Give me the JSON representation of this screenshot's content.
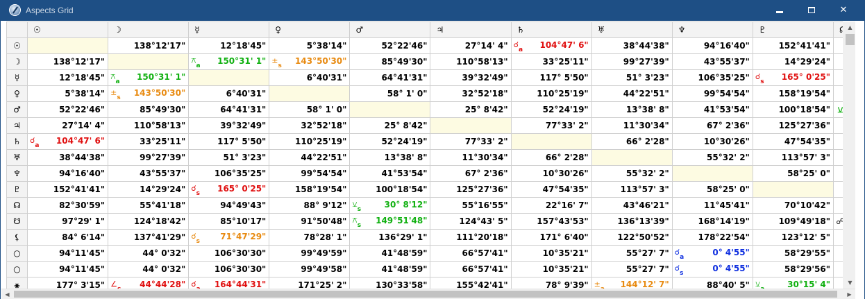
{
  "window": {
    "title": "Aspects Grid",
    "minimize_glyph": "",
    "close_glyph": "✕",
    "icon": "astrology-app-icon"
  },
  "colors": {
    "titlebar": "#1e4f85",
    "glyph_red": "#e01010",
    "aspect_green": "#10b010",
    "aspect_orange": "#e88a10",
    "aspect_red": "#e01010",
    "aspect_blue": "#1030e0",
    "diagonal": "#fdfbe2"
  },
  "grid": {
    "columns": [
      "☉",
      "☽",
      "☿",
      "♀",
      "♂",
      "♃",
      "♄",
      "♅",
      "♆",
      "♇",
      "☊"
    ],
    "rows": [
      {
        "glyph": "☉",
        "cells": [
          {
            "diag": true
          },
          {
            "v": "138°12'17\""
          },
          {
            "v": "12°18'45\""
          },
          {
            "v": "5°38'14\""
          },
          {
            "v": "52°22'46\""
          },
          {
            "v": "27°14' 4\""
          },
          {
            "sym": "☌",
            "sub": "a",
            "v": "104°47' 6\"",
            "c": "red"
          },
          {
            "v": "38°44'38\""
          },
          {
            "v": "94°16'40\""
          },
          {
            "v": "152°41'41\""
          }
        ],
        "edge": ""
      },
      {
        "glyph": "☽",
        "cells": [
          {
            "v": "138°12'17\""
          },
          {
            "diag": true
          },
          {
            "sym": "⚻",
            "sub": "a",
            "v": "150°31' 1\"",
            "c": "green"
          },
          {
            "sym": "±",
            "sub": "s",
            "v": "143°50'30\"",
            "c": "orange"
          },
          {
            "v": "85°49'30\""
          },
          {
            "v": "110°58'13\""
          },
          {
            "v": "33°25'11\""
          },
          {
            "v": "99°27'39\""
          },
          {
            "v": "43°55'37\""
          },
          {
            "v": "14°29'24\""
          }
        ],
        "edge": ""
      },
      {
        "glyph": "☿",
        "cells": [
          {
            "v": "12°18'45\""
          },
          {
            "sym": "⚻",
            "sub": "a",
            "v": "150°31' 1\"",
            "c": "green"
          },
          {
            "diag": true
          },
          {
            "v": "6°40'31\""
          },
          {
            "v": "64°41'31\""
          },
          {
            "v": "39°32'49\""
          },
          {
            "v": "117° 5'50\""
          },
          {
            "v": "51° 3'23\""
          },
          {
            "v": "106°35'25\""
          },
          {
            "sym": "☌",
            "sub": "s",
            "v": "165° 0'25\"",
            "c": "red"
          }
        ],
        "edge": ""
      },
      {
        "glyph": "♀",
        "cells": [
          {
            "v": "5°38'14\""
          },
          {
            "sym": "±",
            "sub": "s",
            "v": "143°50'30\"",
            "c": "orange"
          },
          {
            "v": "6°40'31\""
          },
          {
            "diag": true
          },
          {
            "v": "58° 1' 0\""
          },
          {
            "v": "32°52'18\""
          },
          {
            "v": "110°25'19\""
          },
          {
            "v": "44°22'51\""
          },
          {
            "v": "99°54'54\""
          },
          {
            "v": "158°19'54\""
          }
        ],
        "edge": ""
      },
      {
        "glyph": "♂",
        "cells": [
          {
            "v": "52°22'46\""
          },
          {
            "v": "85°49'30\""
          },
          {
            "v": "64°41'31\""
          },
          {
            "v": "58° 1' 0\""
          },
          {
            "diag": true
          },
          {
            "v": "25° 8'42\""
          },
          {
            "v": "52°24'19\""
          },
          {
            "v": "13°38' 8\""
          },
          {
            "v": "41°53'54\""
          },
          {
            "v": "100°18'54\""
          }
        ],
        "edge": "⚺"
      },
      {
        "glyph": "♃",
        "cells": [
          {
            "v": "27°14' 4\""
          },
          {
            "v": "110°58'13\""
          },
          {
            "v": "39°32'49\""
          },
          {
            "v": "32°52'18\""
          },
          {
            "v": "25° 8'42\""
          },
          {
            "diag": true
          },
          {
            "v": "77°33' 2\""
          },
          {
            "v": "11°30'34\""
          },
          {
            "v": "67° 2'36\""
          },
          {
            "v": "125°27'36\""
          }
        ],
        "edge": ""
      },
      {
        "glyph": "♄",
        "cells": [
          {
            "sym": "☌",
            "sub": "a",
            "v": "104°47' 6\"",
            "c": "red"
          },
          {
            "v": "33°25'11\""
          },
          {
            "v": "117° 5'50\""
          },
          {
            "v": "110°25'19\""
          },
          {
            "v": "52°24'19\""
          },
          {
            "v": "77°33' 2\""
          },
          {
            "diag": true
          },
          {
            "v": "66° 2'28\""
          },
          {
            "v": "10°30'26\""
          },
          {
            "v": "47°54'35\""
          }
        ],
        "edge": ""
      },
      {
        "glyph": "♅",
        "cells": [
          {
            "v": "38°44'38\""
          },
          {
            "v": "99°27'39\""
          },
          {
            "v": "51° 3'23\""
          },
          {
            "v": "44°22'51\""
          },
          {
            "v": "13°38' 8\""
          },
          {
            "v": "11°30'34\""
          },
          {
            "v": "66° 2'28\""
          },
          {
            "diag": true
          },
          {
            "v": "55°32' 2\""
          },
          {
            "v": "113°57' 3\""
          }
        ],
        "edge": ""
      },
      {
        "glyph": "♆",
        "cells": [
          {
            "v": "94°16'40\""
          },
          {
            "v": "43°55'37\""
          },
          {
            "v": "106°35'25\""
          },
          {
            "v": "99°54'54\""
          },
          {
            "v": "41°53'54\""
          },
          {
            "v": "67° 2'36\""
          },
          {
            "v": "10°30'26\""
          },
          {
            "v": "55°32' 2\""
          },
          {
            "diag": true
          },
          {
            "v": "58°25' 0\""
          }
        ],
        "edge": ""
      },
      {
        "glyph": "♇",
        "cells": [
          {
            "v": "152°41'41\""
          },
          {
            "v": "14°29'24\""
          },
          {
            "sym": "☌",
            "sub": "s",
            "v": "165° 0'25\"",
            "c": "red"
          },
          {
            "v": "158°19'54\""
          },
          {
            "v": "100°18'54\""
          },
          {
            "v": "125°27'36\""
          },
          {
            "v": "47°54'35\""
          },
          {
            "v": "113°57' 3\""
          },
          {
            "v": "58°25' 0\""
          },
          {
            "diag": true
          }
        ],
        "edge": ""
      },
      {
        "glyph": "☊",
        "cells": [
          {
            "v": "82°30'59\""
          },
          {
            "v": "55°41'18\""
          },
          {
            "v": "94°49'43\""
          },
          {
            "v": "88° 9'12\""
          },
          {
            "sym": "⚺",
            "sub": "s",
            "v": "30° 8'12\"",
            "c": "green"
          },
          {
            "v": "55°16'55\""
          },
          {
            "v": "22°16' 7\""
          },
          {
            "v": "43°46'21\""
          },
          {
            "v": "11°45'41\""
          },
          {
            "v": "70°10'42\""
          }
        ],
        "edge": ""
      },
      {
        "glyph": "☋",
        "cells": [
          {
            "v": "97°29' 1\""
          },
          {
            "v": "124°18'42\""
          },
          {
            "v": "85°10'17\""
          },
          {
            "v": "91°50'48\""
          },
          {
            "sym": "⚻",
            "sub": "s",
            "v": "149°51'48\"",
            "c": "green"
          },
          {
            "v": "124°43' 5\""
          },
          {
            "v": "157°43'53\""
          },
          {
            "v": "136°13'39\""
          },
          {
            "v": "168°14'19\""
          },
          {
            "v": "109°49'18\""
          }
        ],
        "edge": "☍"
      },
      {
        "glyph": "⚸",
        "cells": [
          {
            "v": "84° 6'14\""
          },
          {
            "v": "137°41'29\""
          },
          {
            "sym": "☌",
            "sub": "s",
            "v": "71°47'29\"",
            "c": "orange"
          },
          {
            "v": "78°28' 1\""
          },
          {
            "v": "136°29' 1\""
          },
          {
            "v": "111°20'18\""
          },
          {
            "v": "171° 6'40\""
          },
          {
            "v": "122°50'52\""
          },
          {
            "v": "178°22'54\""
          },
          {
            "v": "123°12' 5\""
          }
        ],
        "edge": ""
      },
      {
        "glyph": "○",
        "cells": [
          {
            "v": "94°11'45\""
          },
          {
            "v": "44° 0'32\""
          },
          {
            "v": "106°30'30\""
          },
          {
            "v": "99°49'59\""
          },
          {
            "v": "41°48'59\""
          },
          {
            "v": "66°57'41\""
          },
          {
            "v": "10°35'21\""
          },
          {
            "v": "55°27' 7\""
          },
          {
            "sym": "☌",
            "sub": "a",
            "v": "0° 4'55\"",
            "c": "blue"
          },
          {
            "v": "58°29'55\""
          }
        ],
        "edge": ""
      },
      {
        "glyph": "○",
        "cells": [
          {
            "v": "94°11'45\""
          },
          {
            "v": "44° 0'32\""
          },
          {
            "v": "106°30'30\""
          },
          {
            "v": "99°49'58\""
          },
          {
            "v": "41°48'59\""
          },
          {
            "v": "66°57'41\""
          },
          {
            "v": "10°35'21\""
          },
          {
            "v": "55°27' 7\""
          },
          {
            "sym": "☌",
            "sub": "s",
            "v": "0° 4'55\"",
            "c": "blue"
          },
          {
            "v": "58°29'56\""
          }
        ],
        "edge": ""
      },
      {
        "glyph": "⚹",
        "cells": [
          {
            "v": "177° 3'15\""
          },
          {
            "sym": "∠",
            "sub": "s",
            "v": "44°44'28\"",
            "c": "red"
          },
          {
            "sym": "☌",
            "sub": "a",
            "v": "164°44'31\"",
            "c": "red"
          },
          {
            "v": "171°25' 2\""
          },
          {
            "v": "130°33'58\""
          },
          {
            "v": "155°42'41\""
          },
          {
            "v": "78° 9'39\""
          },
          {
            "sym": "±",
            "sub": "a",
            "v": "144°12' 7\"",
            "c": "orange"
          },
          {
            "v": "88°40' 5\""
          },
          {
            "sym": "⚺",
            "sub": "a",
            "v": "30°15' 4\"",
            "c": "green"
          }
        ],
        "edge": ""
      }
    ]
  }
}
